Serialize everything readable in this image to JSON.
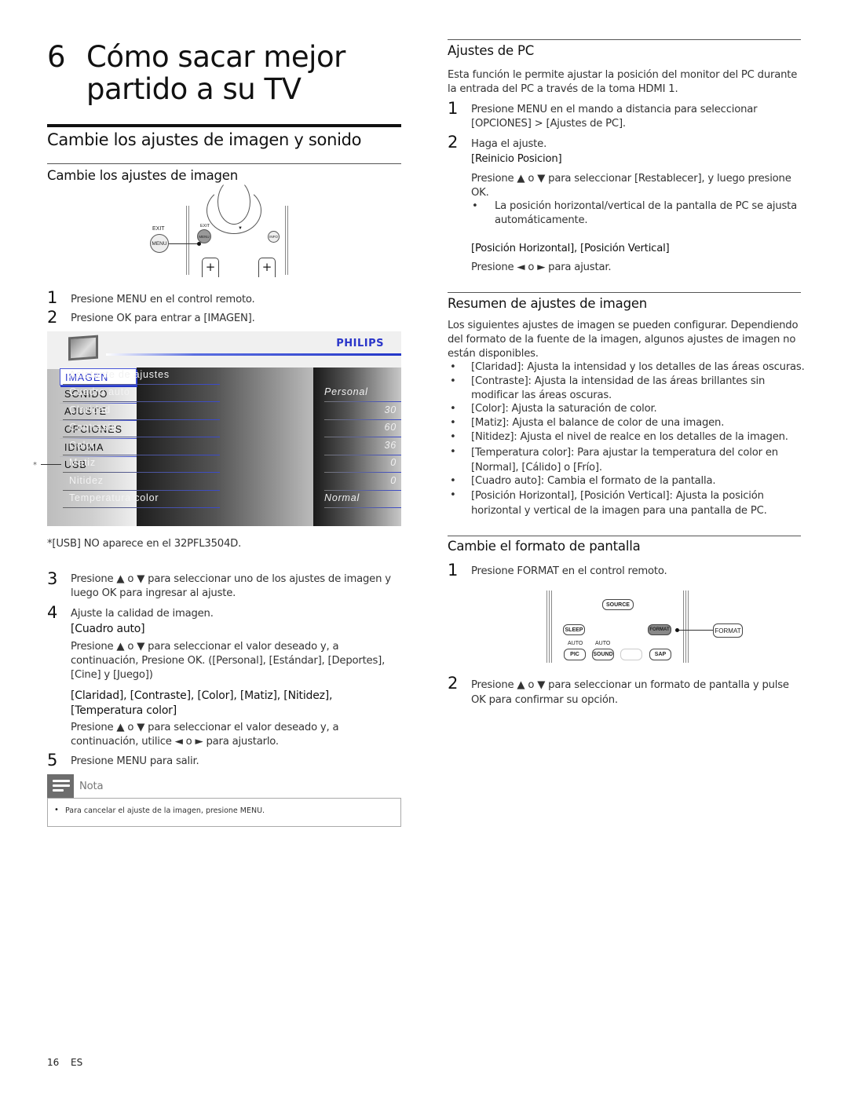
{
  "chapter": {
    "number": "6",
    "title": "Cómo sacar mejor partido a su TV"
  },
  "left": {
    "section_title": "Cambie los ajustes de imagen y sonido",
    "subsection_title": "Cambie los ajustes de imagen",
    "remote1": {
      "exit_label": "EXIT",
      "menu_label": "MENU",
      "info_label": "INFO",
      "plus": "+"
    },
    "steps_a": [
      {
        "num": "1",
        "text": "Presione MENU en el control remoto."
      },
      {
        "num": "2",
        "text": "Presione OK para entrar a [IMAGEN]."
      }
    ],
    "tv_menu": {
      "brand": "PHILIPS",
      "left_items": [
        "IMAGEN",
        "SONIDO",
        "AJUSTE",
        "OPCIONES",
        "IDIOMA",
        "USB"
      ],
      "selected_left": "IMAGEN",
      "settings": [
        {
          "name": "Asistante de ajustes",
          "value": ""
        },
        {
          "name": "Cuadro auto",
          "value": "Personal"
        },
        {
          "name": "Claridad",
          "value": "30"
        },
        {
          "name": "Contraste",
          "value": "60"
        },
        {
          "name": "Color",
          "value": "36"
        },
        {
          "name": "Matiz",
          "value": "0"
        },
        {
          "name": "Nitidez",
          "value": "0"
        },
        {
          "name": "Temperatura color",
          "value": "Normal"
        }
      ],
      "usb_marker": "*"
    },
    "footnote": "*[USB] NO aparece en el 32PFL3504D.",
    "steps_b": [
      {
        "num": "3",
        "text": "Presione ▲ o ▼ para seleccionar uno de los ajustes de imagen y luego OK para ingresar al ajuste."
      },
      {
        "num": "4",
        "text": "Ajuste la calidad de imagen."
      }
    ],
    "cuadro_auto_label": "[Cuadro auto]",
    "cuadro_auto_text": "Presione ▲ o ▼ para seleccionar el valor deseado y, a continuación, Presione OK. ([Personal], [Estándar], [Deportes], [Cine] y [Juego])",
    "params_label": "[Claridad], [Contraste], [Color], [Matiz], [Nitidez], [Temperatura color]",
    "params_text": "Presione ▲ o ▼ para seleccionar el valor deseado y, a continuación, utilice ◄ o ► para ajustarlo.",
    "step5": {
      "num": "5",
      "text": "Presione MENU para salir."
    },
    "note": {
      "title": "Nota",
      "bullet": "Para cancelar el ajuste de la imagen, presione MENU."
    }
  },
  "right": {
    "pc": {
      "title": "Ajustes de PC",
      "intro": "Esta función le permite ajustar la posición del monitor del PC durante la entrada del PC a través de la toma HDMI 1.",
      "step1": {
        "num": "1",
        "text": "Presione MENU en el mando a distancia para seleccionar [OPCIONES] > [Ajustes de PC]."
      },
      "step2": {
        "num": "2",
        "text": "Haga el ajuste."
      },
      "reinicio_label": "[Reinicio Posicion]",
      "reinicio_text": "Presione ▲ o ▼ para seleccionar [Restablecer], y luego presione OK.",
      "reinicio_bullet": "La posición horizontal/vertical de la pantalla de PC se ajusta automáticamente.",
      "pos_label": "[Posición Horizontal], [Posición Vertical]",
      "pos_text": "Presione ◄ o ► para ajustar."
    },
    "summary": {
      "title": "Resumen de ajustes de imagen",
      "intro": "Los siguientes ajustes de imagen se pueden configurar. Dependiendo del formato de la fuente de la imagen, algunos ajustes de imagen no están disponibles.",
      "bullets": [
        "[Claridad]: Ajusta la intensidad y los detalles de las áreas oscuras.",
        "[Contraste]: Ajusta la intensidad de las áreas brillantes sin modificar las áreas oscuras.",
        "[Color]: Ajusta la saturación de color.",
        "[Matiz]: Ajusta el balance de color de una imagen.",
        "[Nitidez]: Ajusta el nivel de realce en los detalles de la imagen.",
        "[Temperatura color]: Para ajustar la temperatura del color en [Normal], [Cálido] o [Frío].",
        "[Cuadro auto]: Cambia el formato de la pantalla.",
        "[Posición Horizontal], [Posición Vertical]: Ajusta la posición horizontal y vertical de la imagen para una pantalla de PC."
      ]
    },
    "format": {
      "title": "Cambie el formato de pantalla",
      "step1": {
        "num": "1",
        "text": "Presione FORMAT en el control remoto."
      },
      "remote2": {
        "source": "SOURCE",
        "sleep": "SLEEP",
        "format": "FORMAT",
        "format_callout": "FORMAT",
        "auto1": "AUTO",
        "auto2": "AUTO",
        "pic": "PIC",
        "sound": "SOUND",
        "sap": "SAP"
      },
      "step2": {
        "num": "2",
        "text": "Presione ▲ o ▼ para seleccionar un formato de pantalla y pulse OK para confirmar su opción."
      }
    }
  },
  "footer": {
    "page": "16",
    "lang": "ES"
  }
}
